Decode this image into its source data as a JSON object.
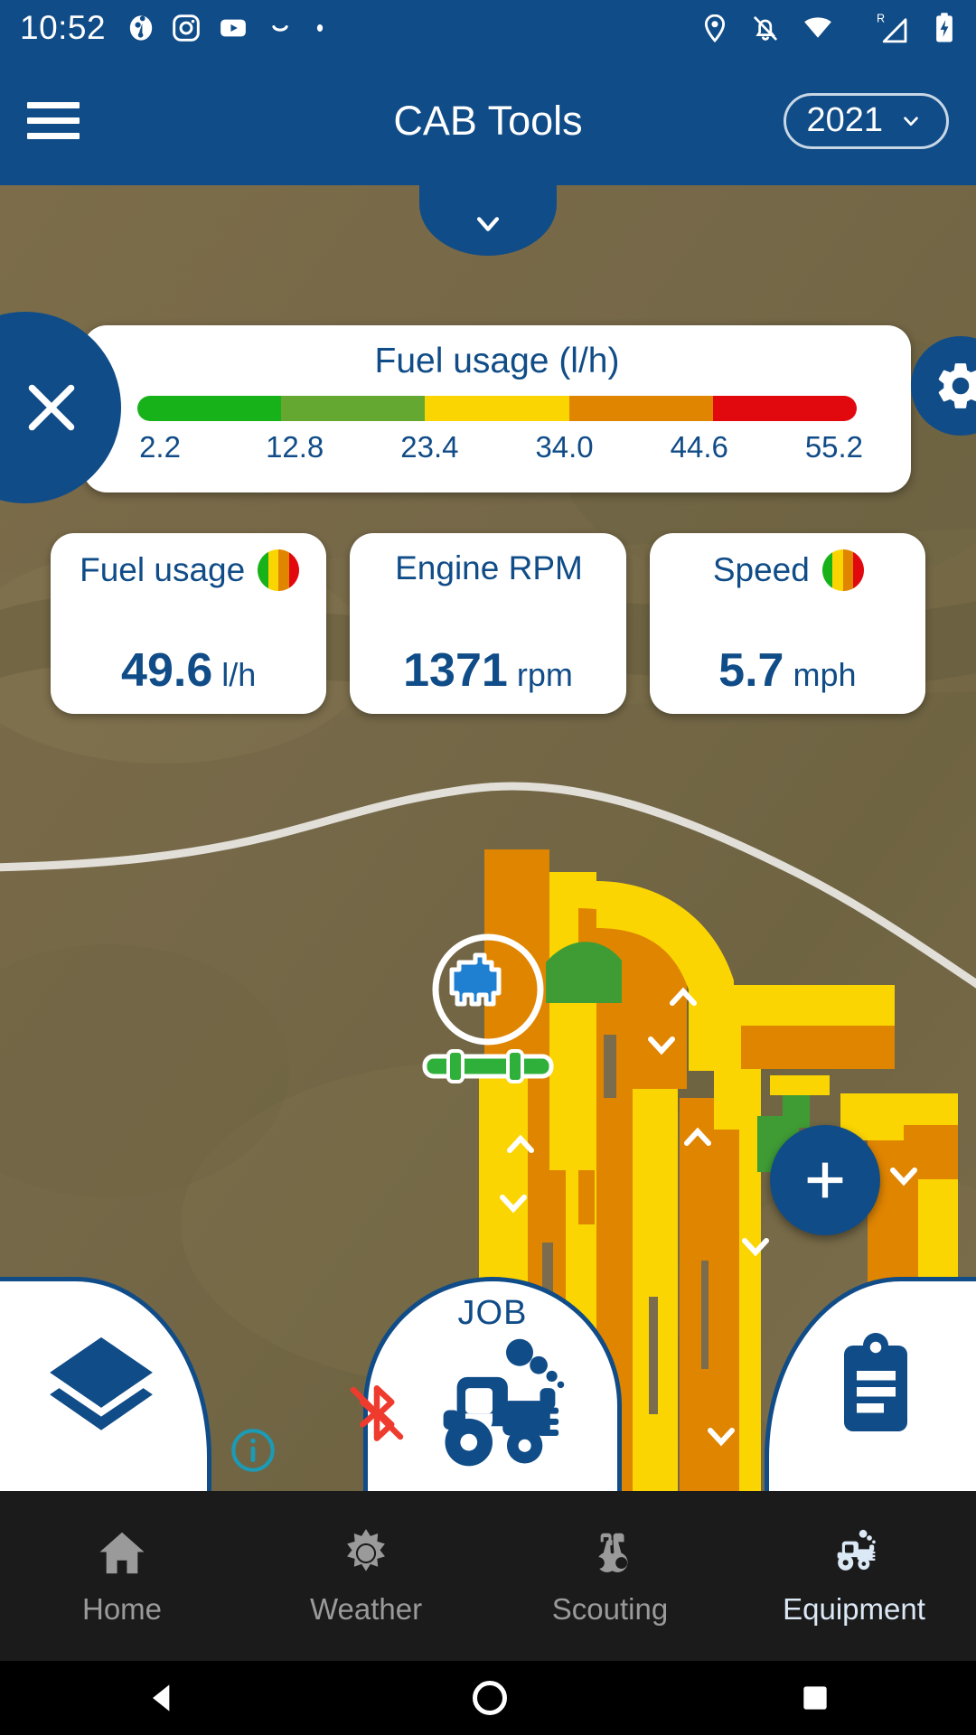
{
  "status_bar": {
    "time": "10:52",
    "left_icons": [
      "reddit-icon",
      "instagram-icon",
      "youtube-icon",
      "swipe-icon",
      "dot-icon"
    ],
    "right_icons": [
      "location-pin-icon",
      "notifications-off-icon",
      "wifi-icon",
      "cellular-roaming-icon",
      "battery-charging-icon"
    ],
    "roaming_label": "R"
  },
  "app_bar": {
    "menu_icon": "hamburger-menu-icon",
    "title": "CAB Tools",
    "year_value": "2021",
    "year_caret": "chevron-down-icon"
  },
  "map": {
    "collapse_icon": "chevron-down-icon",
    "vehicle_marker": "tractor-position-marker",
    "implement_bar": "implement-boom"
  },
  "legend": {
    "title": "Fuel usage (l/h)",
    "close_icon": "close-icon",
    "settings_icon": "gear-icon",
    "segments": [
      "#17b219",
      "#64a831",
      "#fbd502",
      "#e08500",
      "#e1080e"
    ],
    "ticks": [
      "2.2",
      "12.8",
      "23.4",
      "34.0",
      "44.6",
      "55.2"
    ]
  },
  "metrics": [
    {
      "label": "Fuel usage",
      "value": "49.6",
      "unit": "l/h",
      "has_swatch": true,
      "swatch": [
        "#17b219",
        "#fbd502",
        "#e08500",
        "#e1080e"
      ]
    },
    {
      "label": "Engine RPM",
      "value": "1371",
      "unit": "rpm",
      "has_swatch": false,
      "swatch": []
    },
    {
      "label": "Speed",
      "value": "5.7",
      "unit": "mph",
      "has_swatch": true,
      "swatch": [
        "#17b219",
        "#fbd502",
        "#e08500",
        "#e1080e"
      ]
    }
  ],
  "fab": {
    "icon": "plus-icon"
  },
  "actions": {
    "layers_icon": "layers-icon",
    "info_icon": "info-icon",
    "job_label": "JOB",
    "job_icon": "tractor-icon",
    "bluetooth_off_icon": "bluetooth-disabled-icon",
    "notes_icon": "clipboard-icon"
  },
  "bottom_nav": {
    "items": [
      {
        "label": "Home",
        "icon": "home-icon",
        "active": false
      },
      {
        "label": "Weather",
        "icon": "sun-icon",
        "active": false
      },
      {
        "label": "Scouting",
        "icon": "binoculars-icon",
        "active": false
      },
      {
        "label": "Equipment",
        "icon": "tractor-icon",
        "active": true
      }
    ]
  },
  "system_nav": {
    "back": "back-triangle-icon",
    "home": "home-circle-icon",
    "recents": "recents-square-icon"
  },
  "colors": {
    "brand_blue": "#104C87",
    "nav_bg": "#1b1b1b",
    "info_teal": "#1b9bb5",
    "bluetooth_red": "#ef3b2d"
  }
}
